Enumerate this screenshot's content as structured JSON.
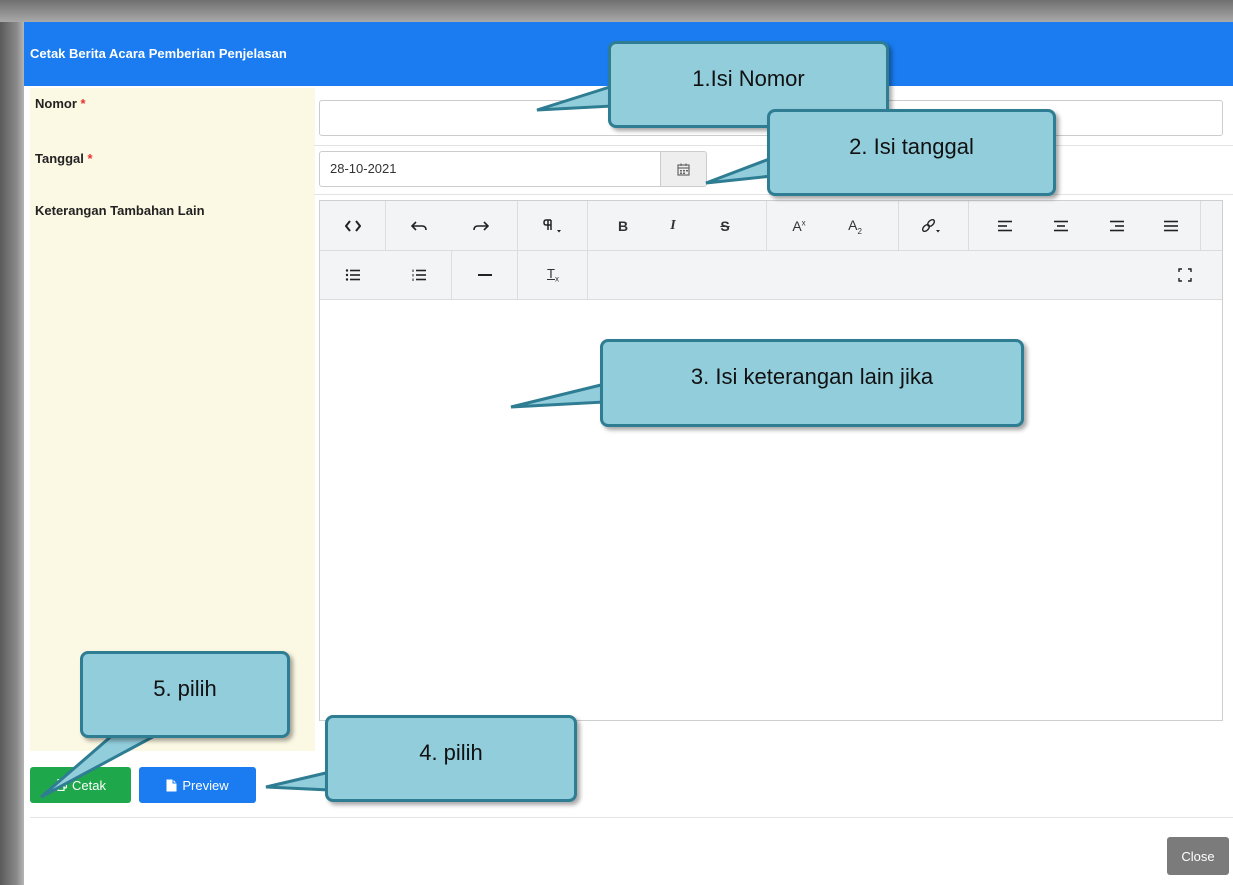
{
  "modal": {
    "title": "Cetak Berita Acara Pemberian Penjelasan",
    "close_label": "Close"
  },
  "form": {
    "nomor": {
      "label": "Nomor",
      "required_mark": "*",
      "value": ""
    },
    "tanggal": {
      "label": "Tanggal",
      "required_mark": "*",
      "value": "28-10-2021",
      "addon_icon": "calendar-icon"
    },
    "keterangan": {
      "label": "Keterangan Tambahan Lain"
    }
  },
  "toolbar": {
    "row1": [
      "code-view-icon",
      "undo-icon",
      "redo-icon",
      "paragraph-icon",
      "bold-icon",
      "italic-icon",
      "strikethrough-icon",
      "superscript-icon",
      "subscript-icon",
      "link-icon",
      "align-left-icon",
      "align-center-icon",
      "align-right-icon",
      "align-justify-icon"
    ],
    "row2": [
      "unordered-list-icon",
      "ordered-list-icon",
      "horizontal-rule-icon",
      "clear-format-icon",
      "fullscreen-icon"
    ]
  },
  "buttons": {
    "cetak": {
      "label": "Cetak",
      "icon": "print-icon",
      "color": "#1ea84b"
    },
    "preview": {
      "label": "Preview",
      "icon": "file-icon",
      "color": "#1a7cf0"
    }
  },
  "callouts": {
    "c1": "1.Isi Nomor",
    "c2": "2. Isi tanggal",
    "c3": "3. Isi keterangan lain jika",
    "c4": "4. pilih",
    "c5": "5. pilih"
  },
  "colors": {
    "header": "#1a7cf0",
    "label_bg": "#fbf8e3",
    "callout_fill": "#92cddc",
    "callout_border": "#2e7d92"
  }
}
